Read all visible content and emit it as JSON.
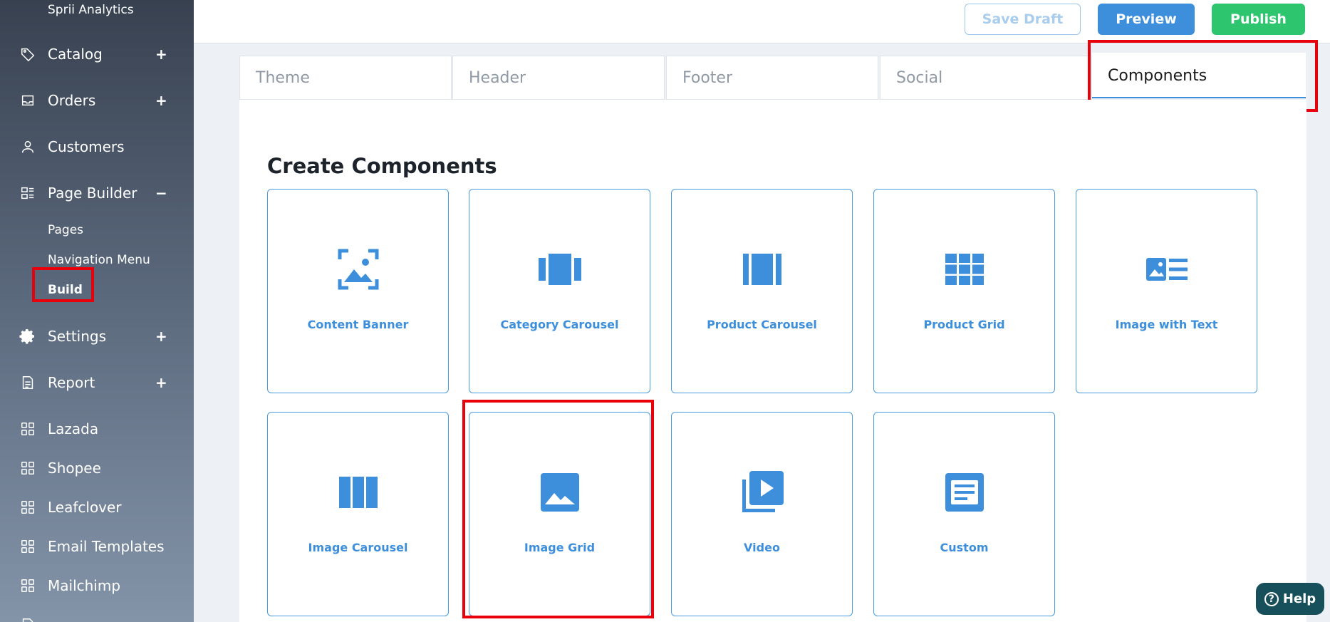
{
  "sidebar": {
    "top_label": "Sprii Analytics",
    "items": [
      {
        "label": "Catalog",
        "toggle": "+"
      },
      {
        "label": "Orders",
        "toggle": "+"
      },
      {
        "label": "Customers",
        "toggle": ""
      },
      {
        "label": "Page Builder",
        "toggle": "−"
      },
      {
        "label": "Settings",
        "toggle": "+"
      },
      {
        "label": "Report",
        "toggle": "+"
      },
      {
        "label": "Lazada",
        "toggle": ""
      },
      {
        "label": "Shopee",
        "toggle": ""
      },
      {
        "label": "Leafclover",
        "toggle": ""
      },
      {
        "label": "Email Templates",
        "toggle": ""
      },
      {
        "label": "Mailchimp",
        "toggle": ""
      }
    ],
    "sub_items": [
      "Pages",
      "Navigation Menu",
      "Build"
    ]
  },
  "toolbar": {
    "save_draft": "Save Draft",
    "preview": "Preview",
    "publish": "Publish"
  },
  "tabs": [
    "Theme",
    "Header",
    "Footer",
    "Social",
    "Components"
  ],
  "main": {
    "title": "Create Components",
    "cards": [
      {
        "label": "Content Banner"
      },
      {
        "label": "Category Carousel"
      },
      {
        "label": "Product Carousel"
      },
      {
        "label": "Product Grid"
      },
      {
        "label": "Image with Text"
      },
      {
        "label": "Image Carousel"
      },
      {
        "label": "Image Grid"
      },
      {
        "label": "Video"
      },
      {
        "label": "Custom"
      }
    ]
  },
  "help": {
    "label": "Help"
  },
  "colors": {
    "accent": "#3d8fdc",
    "publish": "#2ec56f",
    "highlight": "#e8000b"
  }
}
